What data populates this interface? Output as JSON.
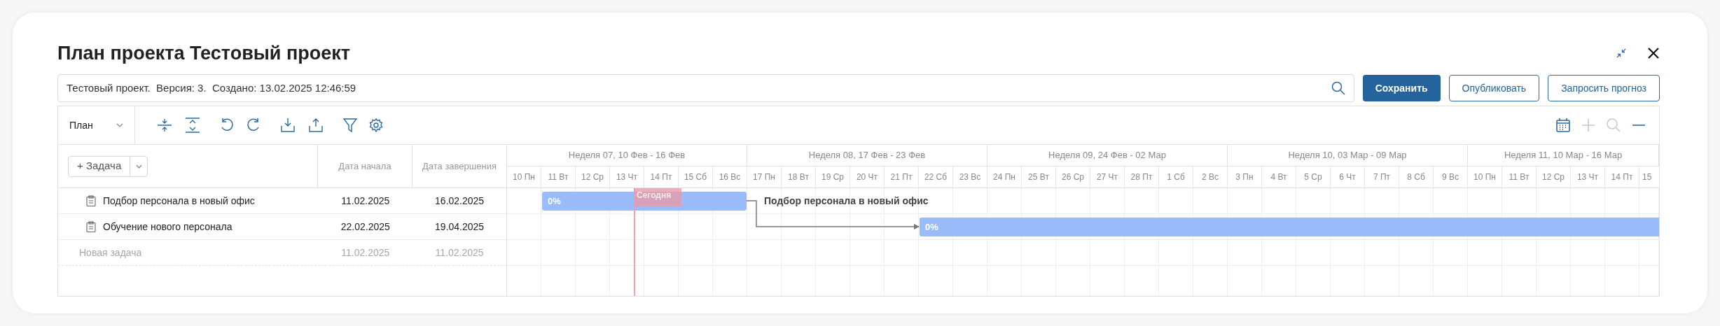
{
  "window": {
    "title": "План проекта Тестовый проект"
  },
  "info_field": {
    "value": "Тестовый проект.  Версия: 3.  Создано: 13.02.2025 12:46:59"
  },
  "buttons": [
    {
      "label": "Сохранить",
      "kind": "primary"
    },
    {
      "label": "Опубликовать",
      "kind": "outline"
    },
    {
      "label": "Запросить прогноз",
      "kind": "outline"
    }
  ],
  "view_select": {
    "value": "План"
  },
  "zoom_controls": [
    {
      "kind": "calendar",
      "disabled": false
    },
    {
      "kind": "zoom-in",
      "disabled": true
    },
    {
      "kind": "search",
      "disabled": true
    },
    {
      "kind": "zoom-out",
      "disabled": false
    }
  ],
  "table": {
    "add_button": "+ Задача",
    "columns": [
      "Дата начала",
      "Дата завершения"
    ],
    "rows": [
      {
        "kind": "task",
        "name": "Подбор персонала в новый офис",
        "start": "11.02.2025",
        "end": "16.02.2025",
        "bar": {
          "progress": "0%",
          "label": "Подбор персонала в новый офис"
        }
      },
      {
        "kind": "task",
        "name": "Обучение нового персонала",
        "start": "22.02.2025",
        "end": "19.04.2025",
        "bar": {
          "progress": "0%",
          "linked_from_previous": true
        }
      },
      {
        "kind": "placeholder",
        "name": "Новая задача",
        "start": "11.02.2025",
        "end": "11.02.2025"
      }
    ]
  },
  "gantt": {
    "weeks": [
      "Неделя 07, 10 Фев - 16 Фев",
      "Неделя 08, 17 Фев - 23 Фев",
      "Неделя 09, 24 Фев - 02 Мар",
      "Неделя 10, 03 Мар - 09 Мар",
      "Неделя 11, 10 Мар - 16 Мар"
    ],
    "days": [
      {
        "label": "10 Пн",
        "today": false
      },
      {
        "label": "11 Вт",
        "today": false
      },
      {
        "label": "12 Ср",
        "today": false
      },
      {
        "label": "13 Чт",
        "today": true
      },
      {
        "label": "14 Пт",
        "today": false
      },
      {
        "label": "15 Сб",
        "today": false
      },
      {
        "label": "16 Вс",
        "today": false
      },
      {
        "label": "17 Пн",
        "today": false
      },
      {
        "label": "18 Вт",
        "today": false
      },
      {
        "label": "19 Ср",
        "today": false
      },
      {
        "label": "20 Чт",
        "today": false
      },
      {
        "label": "21 Пт",
        "today": false
      },
      {
        "label": "22 Сб",
        "today": false
      },
      {
        "label": "23 Вс",
        "today": false
      },
      {
        "label": "24 Пн",
        "today": false
      },
      {
        "label": "25 Вт",
        "today": false
      },
      {
        "label": "26 Ср",
        "today": false
      },
      {
        "label": "27 Чт",
        "today": false
      },
      {
        "label": "28 Пт",
        "today": false
      },
      {
        "label": "1 Сб",
        "today": false
      },
      {
        "label": "2 Вс",
        "today": false
      },
      {
        "label": "3 Пн",
        "today": false
      },
      {
        "label": "4 Вт",
        "today": false
      },
      {
        "label": "5 Ср",
        "today": false
      },
      {
        "label": "6 Чт",
        "today": false
      },
      {
        "label": "7 Пт",
        "today": false
      },
      {
        "label": "8 Сб",
        "today": false
      },
      {
        "label": "9 Вс",
        "today": false
      },
      {
        "label": "10 Пн",
        "today": false
      },
      {
        "label": "11 Вт",
        "today": false
      },
      {
        "label": "12 Ср",
        "today": false
      },
      {
        "label": "13 Чт",
        "today": false
      },
      {
        "label": "14 Пт",
        "today": false
      },
      {
        "label": "15",
        "today": false
      }
    ],
    "today_label": "Сегодня"
  }
}
